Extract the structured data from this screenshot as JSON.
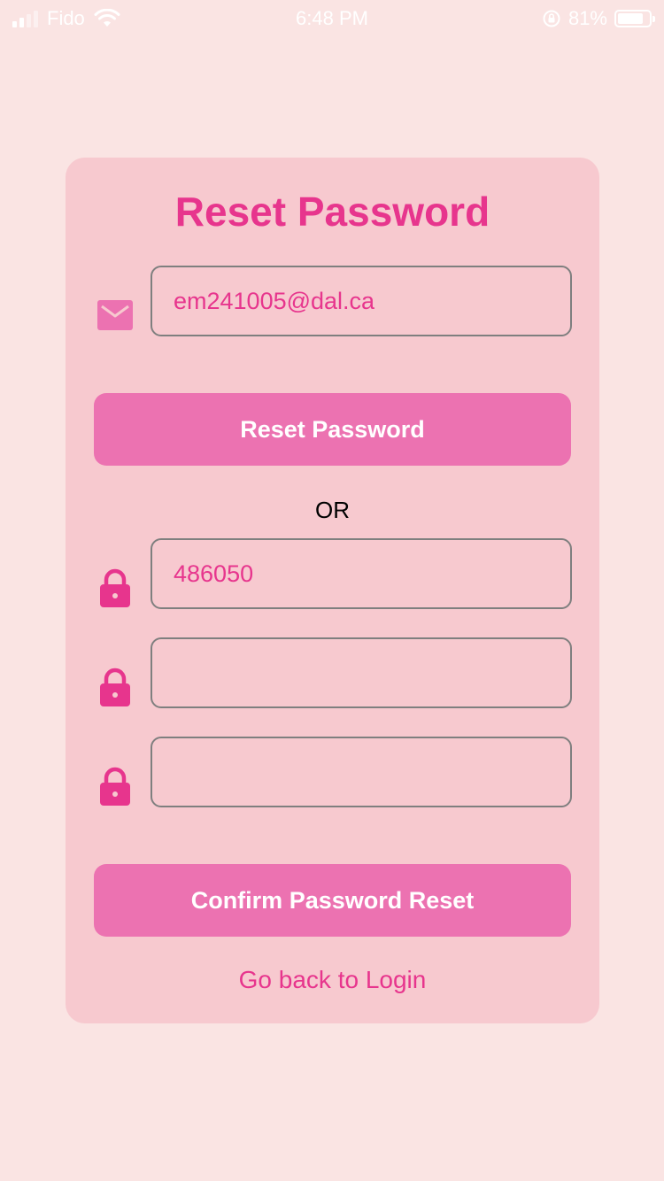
{
  "status_bar": {
    "carrier": "Fido",
    "time": "6:48 PM",
    "battery": "81%",
    "battery_level": 0.81,
    "icons": [
      "signal-icon",
      "wifi-icon",
      "orientation-lock-icon",
      "battery-icon"
    ]
  },
  "reset_form": {
    "title": "Reset Password",
    "email_value": "em241005@dal.ca",
    "reset_button_label": "Reset Password",
    "or_label": "OR",
    "code_value": "486050",
    "new_password_value": "",
    "confirm_password_value": "",
    "confirm_button_label": "Confirm Password Reset",
    "back_link_label": "Go back to Login"
  },
  "colors": {
    "background": "#fae4e3",
    "card": "#f7c9cf",
    "accent": "#e7358d",
    "button": "#ec72b1",
    "input_border": "#7f7f7f"
  }
}
